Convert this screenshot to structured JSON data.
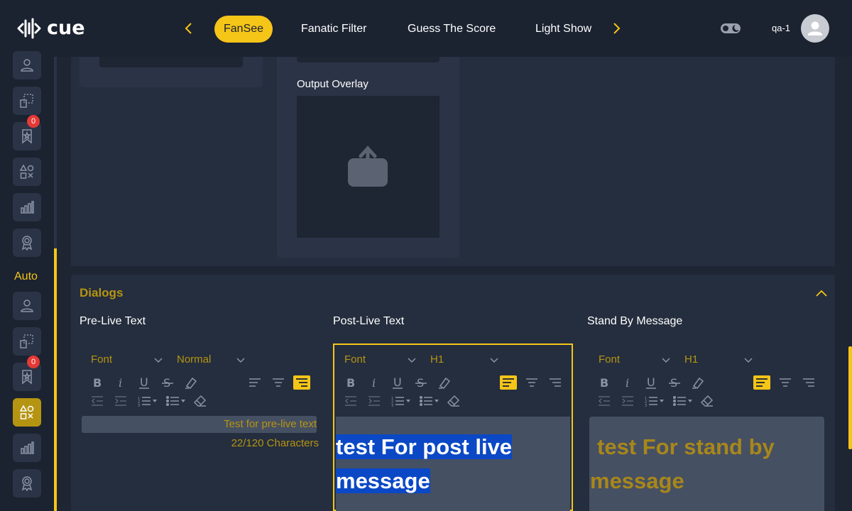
{
  "header": {
    "logo_text": "cue",
    "nav": [
      "FanSee",
      "Fanatic Filter",
      "Guess The Score",
      "Light Show"
    ],
    "active_nav": "FanSee",
    "user_name": "qa-1"
  },
  "sidebar": {
    "section_label": "Auto",
    "badges": [
      "0",
      "0"
    ]
  },
  "top": {
    "output_overlay_label": "Output Overlay"
  },
  "dialogs": {
    "title": "Dialogs",
    "columns": [
      {
        "title": "Pre-Live Text",
        "font_label": "Font",
        "size_label": "Normal",
        "text": "Test for pre-live text",
        "count": "22/120 Characters"
      },
      {
        "title": "Post-Live Text",
        "font_label": "Font",
        "size_label": "H1",
        "text_line1": "test For post live ",
        "text_line2": "message"
      },
      {
        "title": "Stand By Message",
        "font_label": "Font",
        "size_label": "H1",
        "text_line1": "test For stand by",
        "text_line2": "message"
      }
    ]
  },
  "colors": {
    "accent": "#f5c518",
    "accent_dark": "#b59412",
    "bg": "#1e2533",
    "panel": "#252e3e",
    "selection": "#0b48c5"
  }
}
